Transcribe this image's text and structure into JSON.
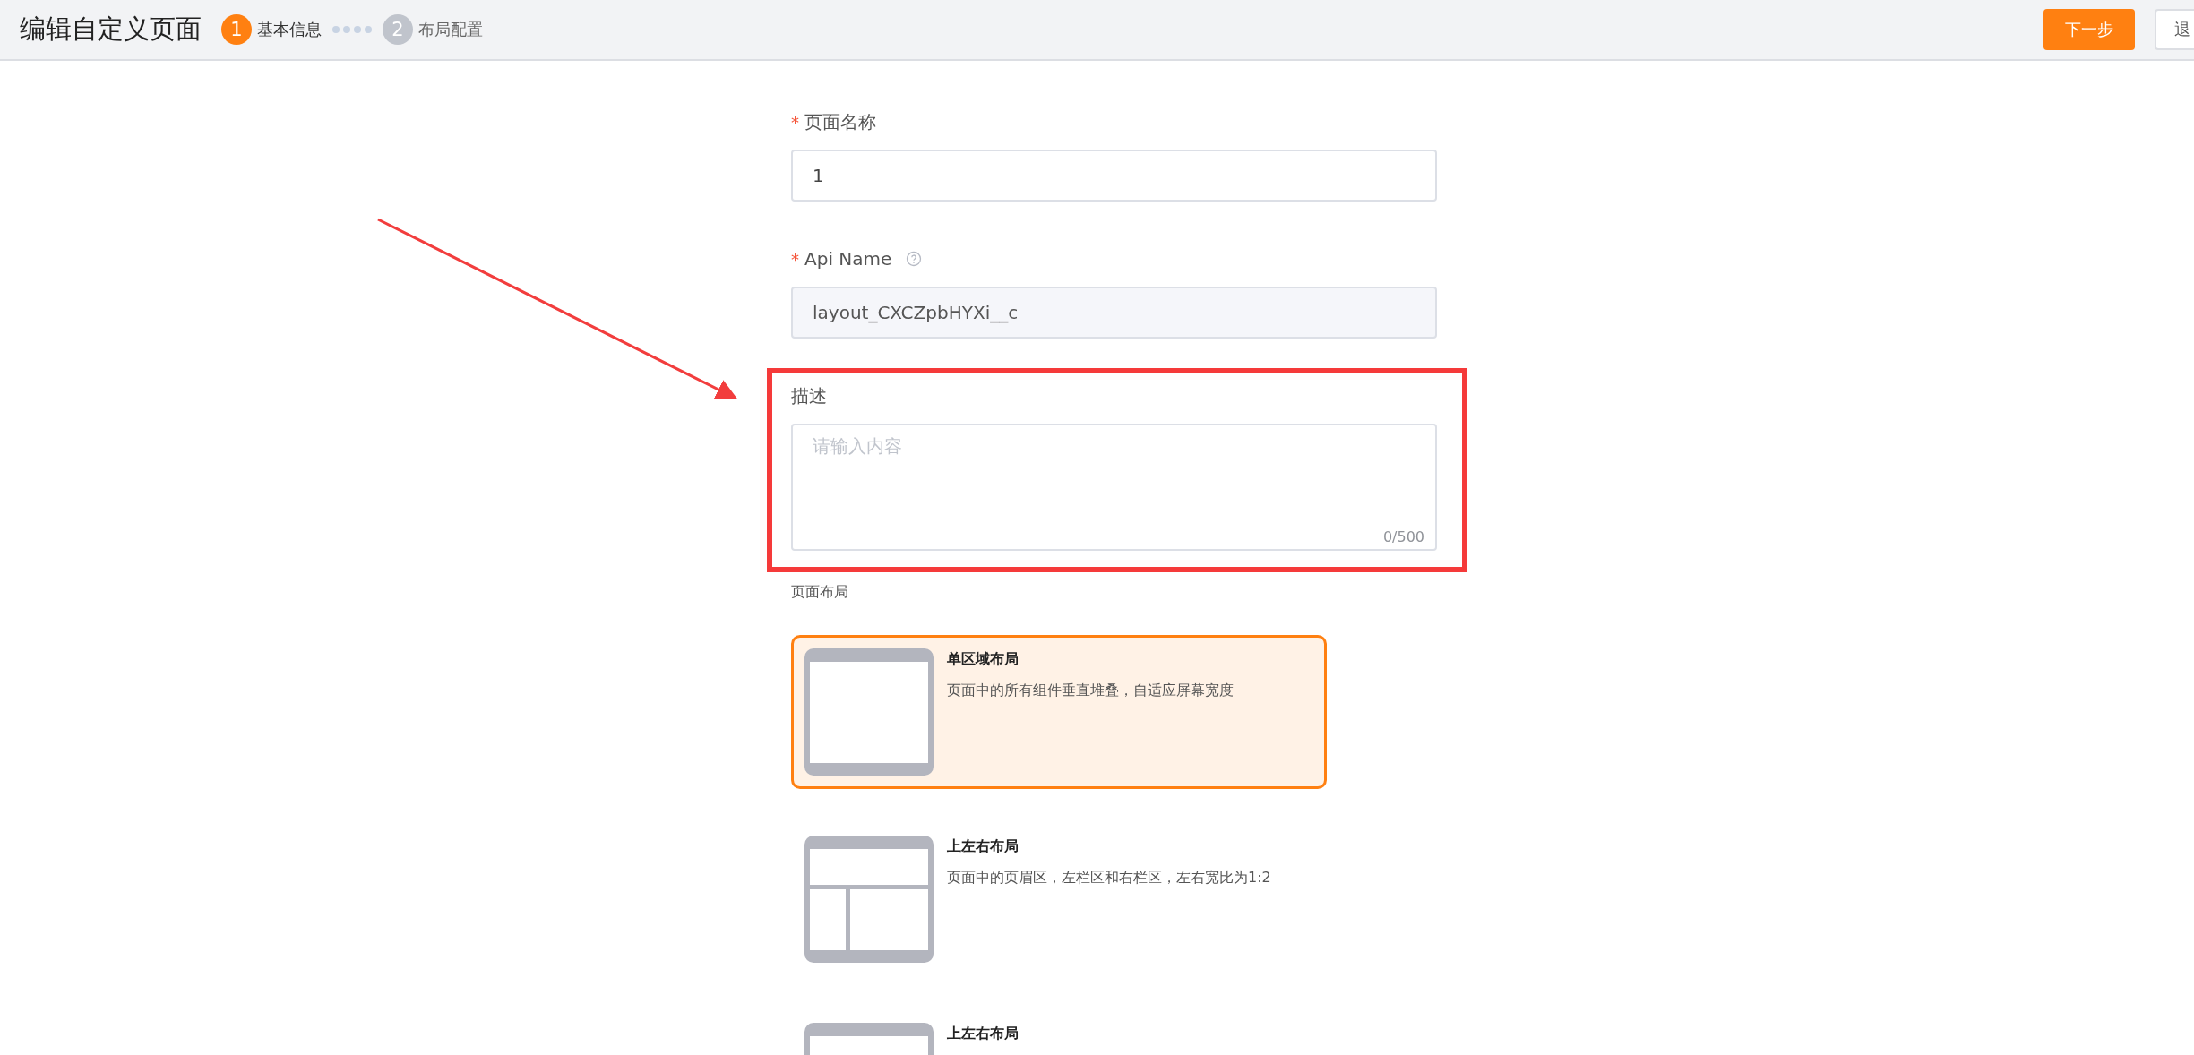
{
  "header": {
    "title": "编辑自定义页面",
    "steps": [
      {
        "number": "1",
        "label": "基本信息",
        "selected": true
      },
      {
        "number": "2",
        "label": "布局配置",
        "selected": false
      }
    ],
    "buttons": [
      {
        "label": "下一步",
        "kind": "primary"
      },
      {
        "label": "退",
        "kind": "default"
      }
    ]
  },
  "form": {
    "fields": [
      {
        "label": "页面名称",
        "required_mark": "*",
        "kind": "input",
        "value": "1",
        "disabled": false,
        "help": false,
        "highlighted": false
      },
      {
        "label": "Api Name",
        "required_mark": "*",
        "kind": "input",
        "value": "layout_CXCZpbHYXi__c",
        "disabled": true,
        "help": true,
        "highlighted": false
      },
      {
        "label": "描述",
        "kind": "textarea",
        "placeholder": "请输入内容",
        "counter": "0/500",
        "help": false,
        "highlighted": true
      }
    ]
  },
  "layout_section": {
    "label": "页面布局",
    "options": [
      {
        "title": "单区域布局",
        "description": "页面中的所有组件垂直堆叠，自适应屏幕宽度",
        "kind": "single",
        "selected": true
      },
      {
        "title": "上左右布局",
        "description": "页面中的页眉区，左栏区和右栏区，左右宽比为1:2",
        "kind": "header-split",
        "selected": false
      },
      {
        "title": "上左右布局",
        "kind": "header-split",
        "selected": false
      }
    ]
  }
}
